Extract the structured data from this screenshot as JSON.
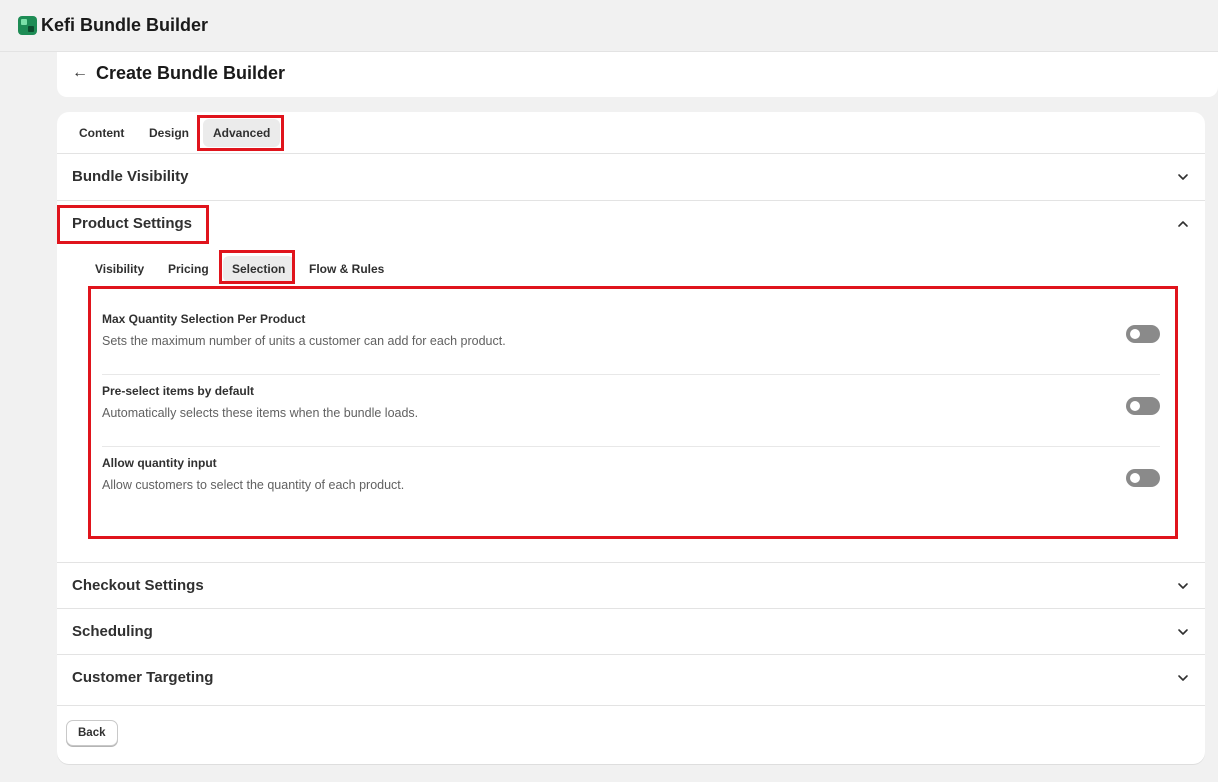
{
  "app": {
    "title": "Kefi Bundle Builder",
    "logo_icon": "kefi-logo-icon"
  },
  "header": {
    "back_icon": "←",
    "title": "Create Bundle Builder"
  },
  "tabs": [
    {
      "label": "Content"
    },
    {
      "label": "Design"
    },
    {
      "label": "Advanced",
      "active": true
    }
  ],
  "sections": {
    "bundle_visibility": {
      "title": "Bundle Visibility",
      "expanded": false
    },
    "product_settings": {
      "title": "Product Settings",
      "expanded": true,
      "subtabs": [
        {
          "label": "Visibility"
        },
        {
          "label": "Pricing"
        },
        {
          "label": "Selection",
          "active": true
        },
        {
          "label": "Flow & Rules"
        }
      ],
      "settings": [
        {
          "label": "Max Quantity Selection Per Product",
          "description": "Sets the maximum number of units a customer can add for each product.",
          "enabled": false
        },
        {
          "label": "Pre-select items by default",
          "description": "Automatically selects these items when the bundle loads.",
          "enabled": false
        },
        {
          "label": "Allow quantity input",
          "description": "Allow customers to select the quantity of each product.",
          "enabled": false
        }
      ]
    },
    "checkout_settings": {
      "title": "Checkout Settings",
      "expanded": false
    },
    "scheduling": {
      "title": "Scheduling",
      "expanded": false
    },
    "customer_targeting": {
      "title": "Customer Targeting",
      "expanded": false
    }
  },
  "footer": {
    "back_label": "Back"
  },
  "colors": {
    "highlight": "#e0141c",
    "toggle_off": "#8a8a8a",
    "active_tab_bg": "#ebebeb"
  }
}
